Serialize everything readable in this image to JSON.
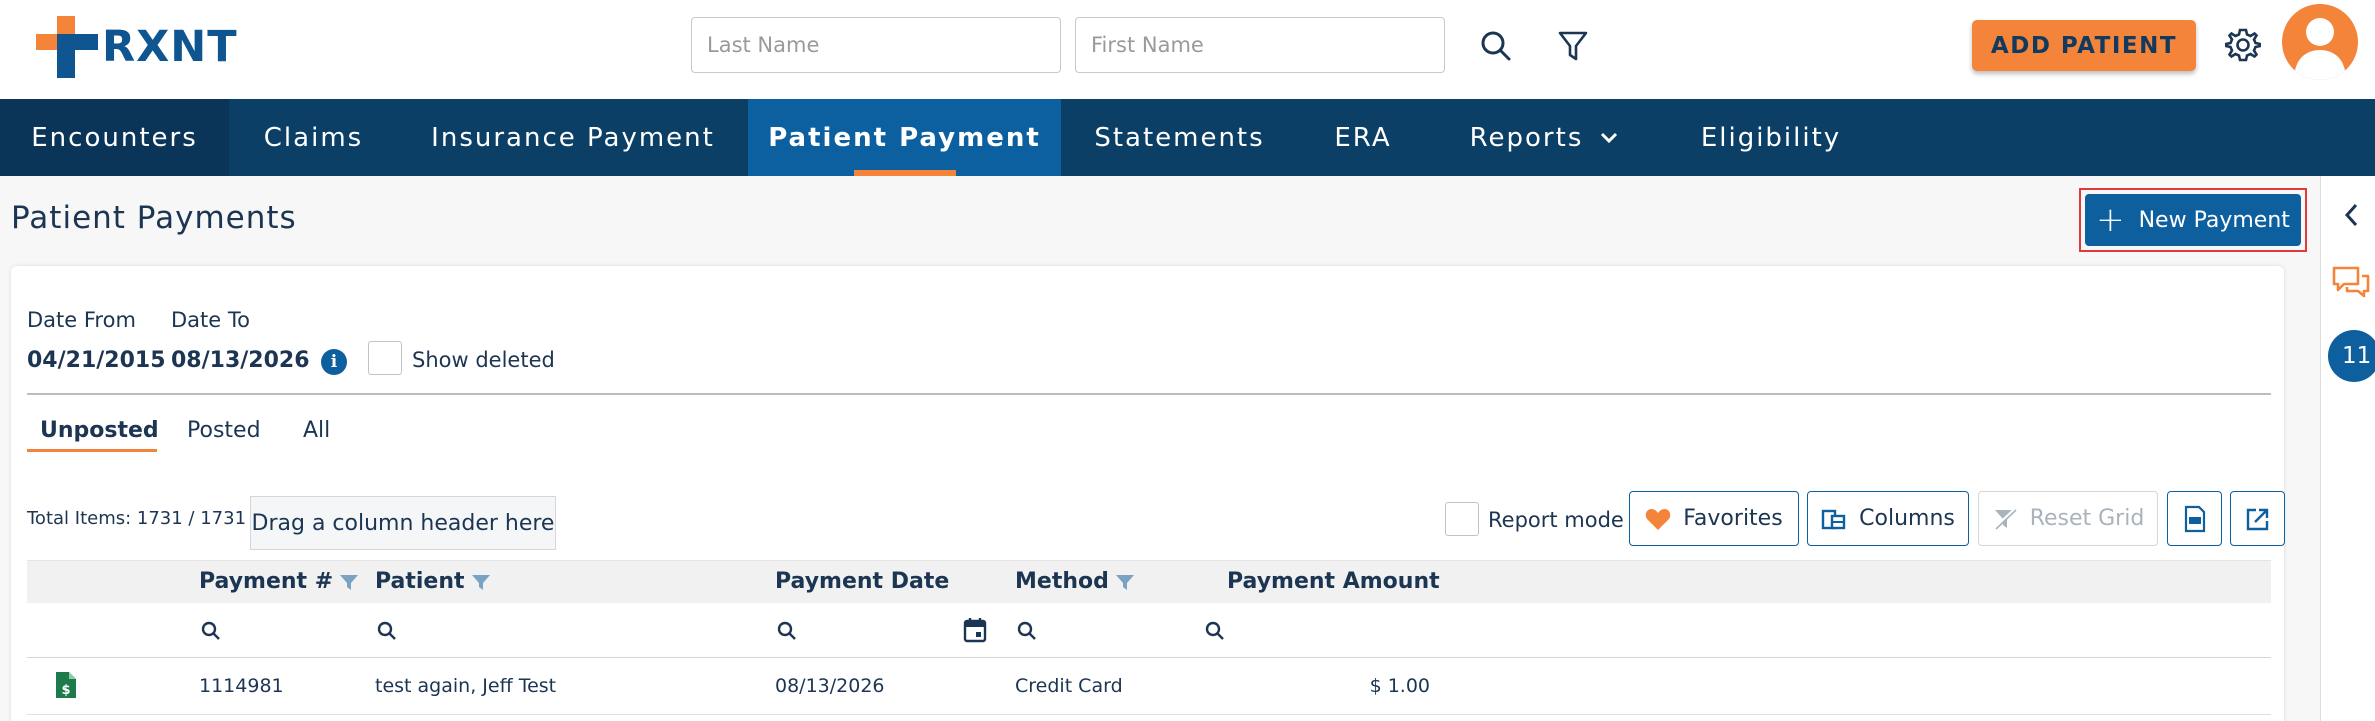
{
  "header": {
    "logo_text": "RXNT",
    "last_name_placeholder": "Last Name",
    "first_name_placeholder": "First Name",
    "add_patient_label": "ADD PATIENT"
  },
  "nav": {
    "items": [
      {
        "label": "Encounters"
      },
      {
        "label": "Claims"
      },
      {
        "label": "Insurance Payment"
      },
      {
        "label": "Patient Payment"
      },
      {
        "label": "Statements"
      },
      {
        "label": "ERA"
      },
      {
        "label": "Reports"
      },
      {
        "label": "Eligibility"
      }
    ],
    "active": "Patient Payment"
  },
  "page": {
    "title": "Patient Payments",
    "new_payment_label": "New Payment"
  },
  "filters": {
    "date_from_label": "Date From",
    "date_from_value": "04/21/2015",
    "date_to_label": "Date To",
    "date_to_value": "08/13/2026",
    "show_deleted_label": "Show deleted"
  },
  "tabs": [
    {
      "label": "Unposted"
    },
    {
      "label": "Posted"
    },
    {
      "label": "All"
    }
  ],
  "toolbar": {
    "total_items": "Total Items: 1731 / 1731",
    "drag_hint": "Drag a column header here",
    "report_mode_label": "Report mode",
    "favorites_label": "Favorites",
    "columns_label": "Columns",
    "reset_grid_label": "Reset Grid"
  },
  "grid": {
    "columns": [
      "Payment #",
      "Patient",
      "Payment Date",
      "Method",
      "Payment Amount"
    ],
    "rows": [
      {
        "payment_no": "1114981",
        "patient": "test again, Jeff Test",
        "payment_date": "08/13/2026",
        "method": "Credit Card",
        "amount": "$ 1.00"
      }
    ]
  },
  "rail": {
    "badge": "11"
  },
  "colors": {
    "brand_orange": "#f5843b",
    "brand_blue": "#0d5f9e",
    "nav_bg": "#0c3f66",
    "highlight_red": "#e03a3a"
  }
}
